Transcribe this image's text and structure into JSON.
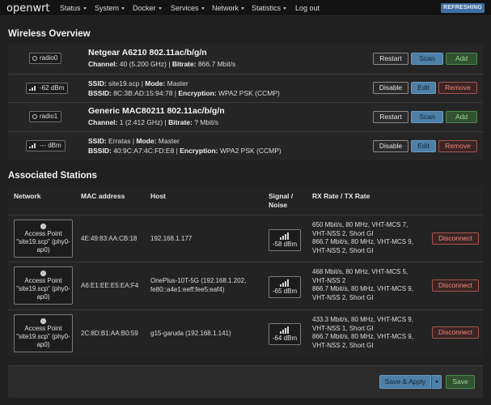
{
  "brand": "openwrt",
  "nav": {
    "items": [
      "Status",
      "System",
      "Docker",
      "Services",
      "Network",
      "Statistics",
      "Log out"
    ],
    "status_badge": "REFRESHING"
  },
  "wireless": {
    "title": "Wireless Overview",
    "radios": [
      {
        "badge": "radio0",
        "title": "Netgear A6210 802.11ac/b/g/n",
        "channel_label": "Channel:",
        "channel": "40 (5.200 GHz)",
        "bitrate_label": "Bitrate:",
        "bitrate": "866.7 Mbit/s",
        "buttons": [
          "Restart",
          "Scan",
          "Add"
        ],
        "network": {
          "signal": "-62 dBm",
          "ssid_label": "SSID:",
          "ssid": "site19.scp",
          "mode_label": "Mode:",
          "mode": "Master",
          "bssid_label": "BSSID:",
          "bssid": "8C:3B:AD:15:94:78",
          "enc_label": "Encryption:",
          "enc": "WPA2 PSK (CCMP)",
          "buttons": [
            "Disable",
            "Edit",
            "Remove"
          ]
        }
      },
      {
        "badge": "radio1",
        "title": "Generic MAC80211 802.11ac/b/g/n",
        "channel_label": "Channel:",
        "channel": "1 (2.412 GHz)",
        "bitrate_label": "Bitrate:",
        "bitrate": "? Mbit/s",
        "buttons": [
          "Restart",
          "Scan",
          "Add"
        ],
        "network": {
          "signal": "--- dBm",
          "ssid_label": "SSID:",
          "ssid": "Erratas",
          "mode_label": "Mode:",
          "mode": "Master",
          "bssid_label": "BSSID:",
          "bssid": "40:9C:A7:4C:FD:E8",
          "enc_label": "Encryption:",
          "enc": "WPA2 PSK (CCMP)",
          "buttons": [
            "Disable",
            "Edit",
            "Remove"
          ]
        }
      }
    ]
  },
  "stations": {
    "title": "Associated Stations",
    "headers": {
      "network": "Network",
      "mac": "MAC address",
      "host": "Host",
      "signal_line1": "Signal /",
      "signal_line2": "Noise",
      "rate": "RX Rate / TX Rate"
    },
    "rows": [
      {
        "ap": [
          "Access Point",
          "\"site19.scp\" (phy0-",
          "ap0)"
        ],
        "mac": "4E:49:83:AA:CB:18",
        "host": [
          "192.168.1.177"
        ],
        "signal": "-58 dBm",
        "rate": [
          "650 Mbit/s, 80 MHz, VHT-MCS 7,",
          "VHT-NSS 2, Short GI",
          "866.7 Mbit/s, 80 MHz, VHT-MCS 9,",
          "VHT-NSS 2, Short GI"
        ],
        "action": "Disconnect"
      },
      {
        "ap": [
          "Access Point",
          "\"site19.scp\" (phy0-",
          "ap0)"
        ],
        "mac": "A6:E1:EE:E5:EA:F4",
        "host": [
          "OnePlus-10T-5G (192.168.1.202,",
          "fe80::a4e1:eeff:fee5:eaf4)"
        ],
        "signal": "-65 dBm",
        "rate": [
          "468 Mbit/s, 80 MHz, VHT-MCS 5,",
          "VHT-NSS 2",
          "866.7 Mbit/s, 80 MHz, VHT-MCS 9,",
          "VHT-NSS 2, Short GI"
        ],
        "action": "Disconnect"
      },
      {
        "ap": [
          "Access Point",
          "\"site19.scp\" (phy0-",
          "ap0)"
        ],
        "mac": "2C:8D:B1:AA:B0:59",
        "host": [
          "g15-garuda (192.168.1.141)"
        ],
        "signal": "-64 dBm",
        "rate": [
          "433.3 Mbit/s, 80 MHz, VHT-MCS 9,",
          "VHT-NSS 1, Short GI",
          "866.7 Mbit/s, 80 MHz, VHT-MCS 9,",
          "VHT-NSS 2, Short GI"
        ],
        "action": "Disconnect"
      }
    ]
  },
  "footer": {
    "save_apply": "Save & Apply",
    "save": "Save"
  }
}
